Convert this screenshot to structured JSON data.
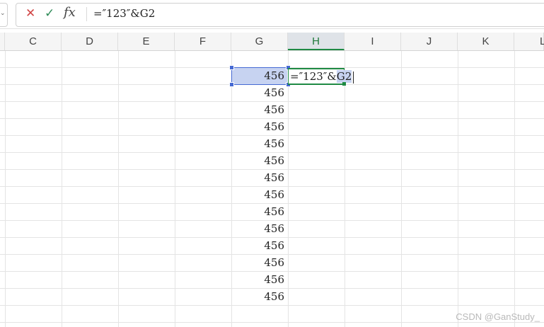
{
  "formula_bar": {
    "cancel_icon": "cross-icon",
    "confirm_icon": "check-icon",
    "fx_label": "fx",
    "formula": "=″123″&G2"
  },
  "columns": [
    "C",
    "D",
    "E",
    "F",
    "G",
    "H",
    "I",
    "J",
    "K",
    "L"
  ],
  "active_column": "H",
  "cells": {
    "G_values": [
      "456",
      "456",
      "456",
      "456",
      "456",
      "456",
      "456",
      "456",
      "456",
      "456",
      "456",
      "456",
      "456",
      "456"
    ],
    "H2_prefix": "=″123″&",
    "H2_ref": "G2"
  },
  "colors": {
    "selection_fill": "#c7d3f1",
    "selection_border": "#4569d3",
    "active_border": "#1f8a44"
  },
  "watermark": "CSDN @GanStudy_"
}
